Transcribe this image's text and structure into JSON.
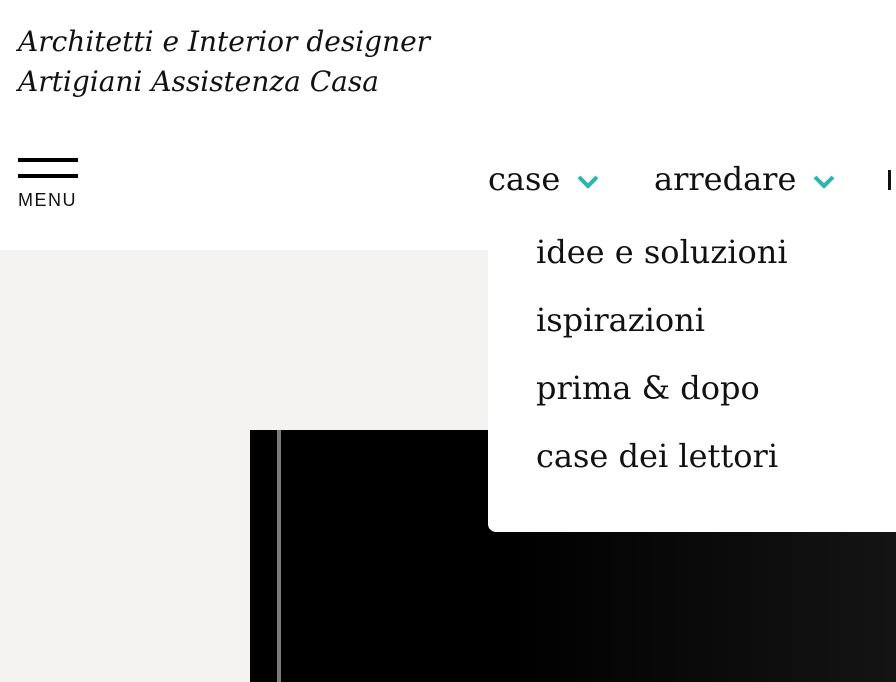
{
  "header": {
    "top_links": [
      {
        "label": "Architetti e Interior designer"
      },
      {
        "label": "Artigiani Assistenza Casa"
      }
    ],
    "menu_label": "MENU"
  },
  "nav": {
    "items": [
      {
        "label": "case",
        "expanded": true
      },
      {
        "label": "arredare",
        "expanded": false
      }
    ],
    "accent_color": "#2bb5b0"
  },
  "dropdown": {
    "items": [
      {
        "label": "idee e soluzioni"
      },
      {
        "label": "ispirazioni"
      },
      {
        "label": "prima & dopo"
      },
      {
        "label": "case dei lettori"
      }
    ]
  },
  "colors": {
    "page_background": "#ffffff",
    "content_background": "#f4f3f1",
    "hero_background": "#000000"
  }
}
